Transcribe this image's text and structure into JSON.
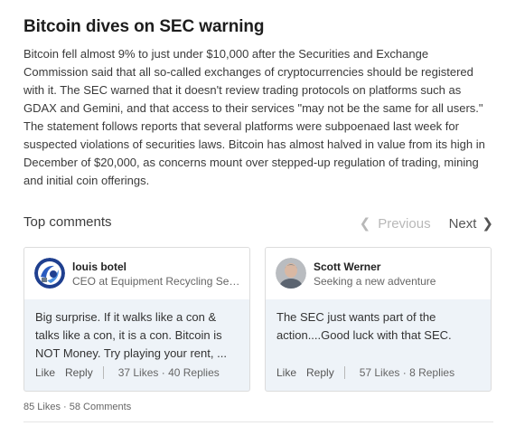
{
  "article": {
    "headline": "Bitcoin dives on SEC warning",
    "body": "Bitcoin fell almost 9% to just under $10,000 after the Securities and Exchange Commission said that all so-called exchanges of cryptocurrencies should be registered with it. The SEC warned that it doesn't review trading protocols on platforms such as GDAX and Gemini, and that access to their services \"may not be the same for all users.\" The statement follows reports that several platforms were subpoenaed last week for suspected violations of securities laws. Bitcoin has almost halved in value from its high in December of $20,000, as concerns mount over stepped-up regulation of trading, mining and initial coin offerings."
  },
  "comments_section": {
    "title": "Top comments",
    "previous_label": "Previous",
    "next_label": "Next"
  },
  "comments": [
    {
      "author": "louis botel",
      "subtitle": "CEO at Equipment Recycling Servi...",
      "text": "Big surprise. If it walks like a con & talks like a con, it is a con. Bitcoin is NOT Money. Try playing your rent, ...",
      "like_label": "Like",
      "reply_label": "Reply",
      "stats": "37 Likes · 40 Replies",
      "avatar_icon": "logo-avatar"
    },
    {
      "author": "Scott Werner",
      "subtitle": "Seeking a new adventure",
      "text": "The SEC just wants part of the action....Good luck with that SEC.",
      "like_label": "Like",
      "reply_label": "Reply",
      "stats": "57 Likes · 8 Replies",
      "avatar_icon": "person-photo-avatar"
    }
  ],
  "post": {
    "stats": "85 Likes · 58 Comments"
  },
  "colors": {
    "card_bg": "#eef3f8",
    "disabled": "#b8b8b8",
    "text": "#333333"
  }
}
